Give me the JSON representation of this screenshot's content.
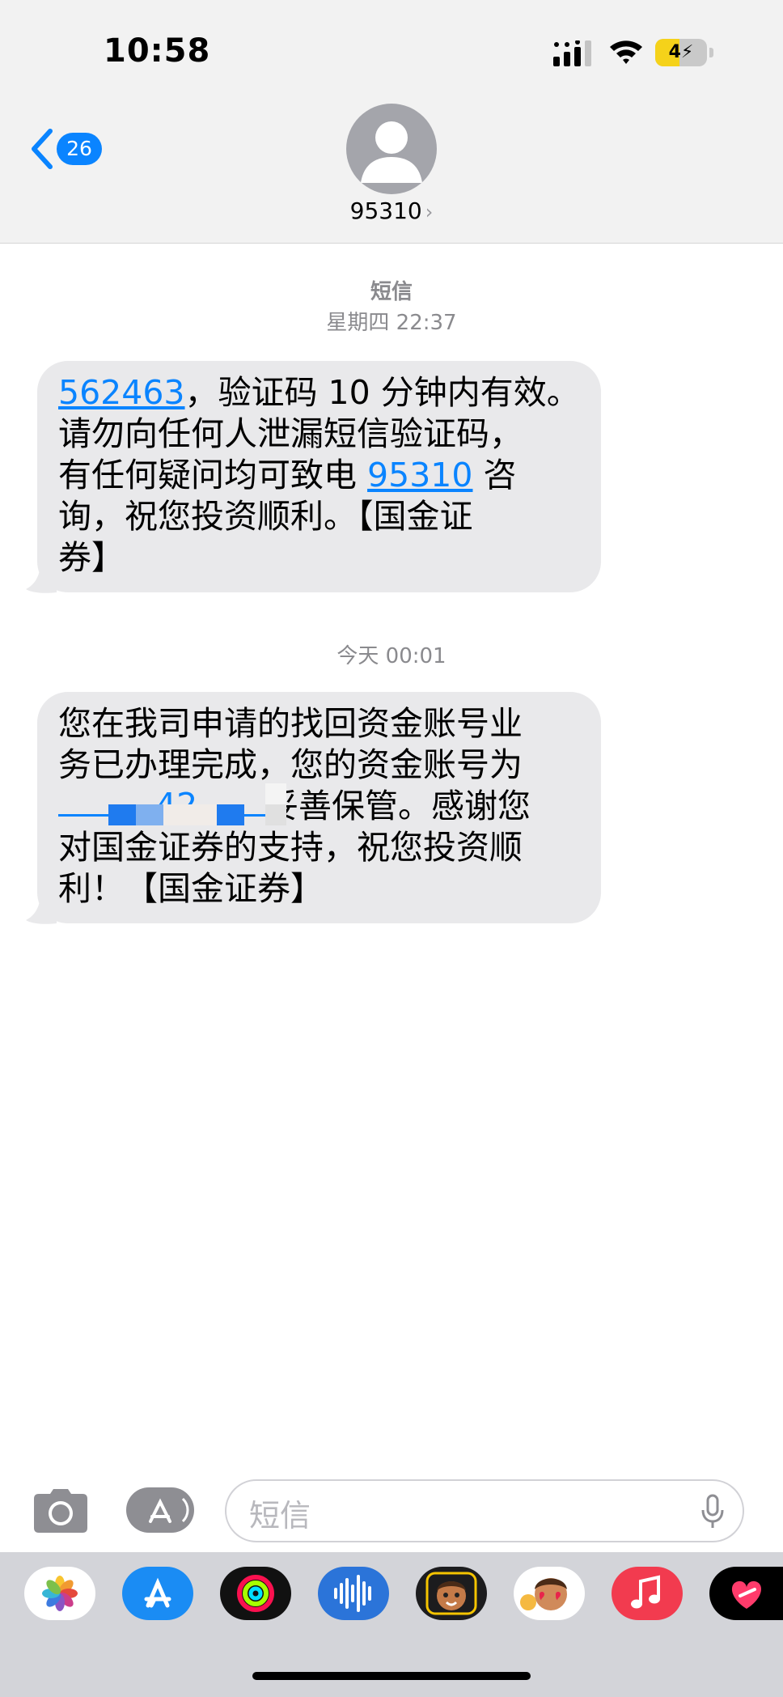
{
  "status_bar": {
    "time": "10:58",
    "battery_level": "4"
  },
  "header": {
    "back_count": "26",
    "contact_name": "95310",
    "chevron": "›"
  },
  "thread": {
    "service_label": "短信",
    "date_1": "星期四 22:37",
    "message_1": {
      "code": "562463",
      "text_after_code": "，验证码 10 分钟内有效。",
      "line_2": "请勿向任何人泄漏短信验证码，",
      "line_3_prefix": "有任何疑问均可致电 ",
      "phone": "95310",
      "line_3_suffix": " 咨",
      "line_4": "询，祝您投资顺利。【国金证",
      "line_5": "券】"
    },
    "date_2": "今天 00:01",
    "message_2": {
      "line_1": "您在我司申请的找回资金账号业",
      "line_2": "务已办理完成，您的资金账号为",
      "account_visible": "42",
      "line_3_suffix": "妥善保管。感谢您",
      "line_4": "对国金证券的支持，祝您投资顺",
      "line_5": "利！【国金证券】"
    }
  },
  "composer": {
    "placeholder": "短信"
  },
  "app_tray": {
    "apps": [
      "photos-icon",
      "app-store-icon",
      "fitness-icon",
      "audio-message-icon",
      "memoji-icon",
      "memoji-stickers-icon",
      "music-icon",
      "digital-touch-icon"
    ]
  },
  "colors": {
    "accent": "#0a84ff",
    "bubble": "#e9e9eb",
    "header_bg": "#f2f2f2",
    "tray_bg": "#d3d4d9"
  }
}
